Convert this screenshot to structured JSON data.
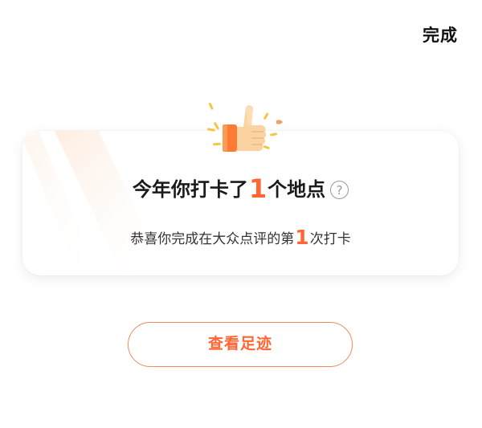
{
  "header": {
    "done_label": "完成"
  },
  "card": {
    "title_prefix": "今年你打卡了",
    "title_count": "1",
    "title_suffix": "个地点",
    "help_symbol": "?",
    "subtitle_prefix": "恭喜你完成在大众点评的第",
    "subtitle_count": "1",
    "subtitle_suffix": "次打卡",
    "badge_icon": "thumbs-up-icon"
  },
  "footer": {
    "view_footprint_label": "查看足迹"
  },
  "colors": {
    "accent": "#ff6633",
    "button_border": "#f08a5d",
    "thumb_skin": "#fbd3a0",
    "confetti": "#f6c543"
  }
}
